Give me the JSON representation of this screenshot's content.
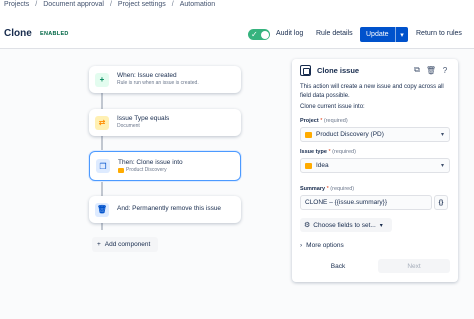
{
  "breadcrumb": [
    "Projects",
    "Document approval",
    "Project settings",
    "Automation"
  ],
  "header": {
    "title": "Clone",
    "status": "ENABLED",
    "audit_log": "Audit log",
    "rule_details": "Rule details",
    "update": "Update",
    "return": "Return to rules"
  },
  "flow": {
    "nodes": [
      {
        "title": "When: Issue created",
        "subtitle": "Rule is run when an issue is created."
      },
      {
        "title": "Issue Type equals",
        "subtitle": "Document"
      },
      {
        "title": "Then: Clone issue into",
        "subtitle": "Product Discovery"
      },
      {
        "title": "And: Permanently remove this issue",
        "subtitle": ""
      }
    ],
    "add_component": "Add component"
  },
  "panel": {
    "title": "Clone issue",
    "description": "This action will create a new issue and copy across all field data possible.",
    "subtitle": "Clone current issue into:",
    "project_label": "Project",
    "project_value": "Product Discovery (PD)",
    "issue_type_label": "Issue type",
    "issue_type_value": "Idea",
    "summary_label": "Summary",
    "summary_value": "CLONE – {{issue.summary}}",
    "required": "(required)",
    "curly": "{}",
    "choose_fields": "Choose fields to set...",
    "more_options": "More options",
    "back": "Back",
    "next": "Next"
  },
  "colors": {
    "primary": "#0052cc",
    "enabled_text": "#006644",
    "toggle_on": "#36b37e",
    "selected_border": "#4c9aff"
  },
  "icons": [
    "plus-icon",
    "shuffle-icon",
    "copy-icon",
    "trash-icon",
    "gear-icon",
    "chevron-down-icon",
    "chevron-right-icon",
    "help-icon"
  ]
}
